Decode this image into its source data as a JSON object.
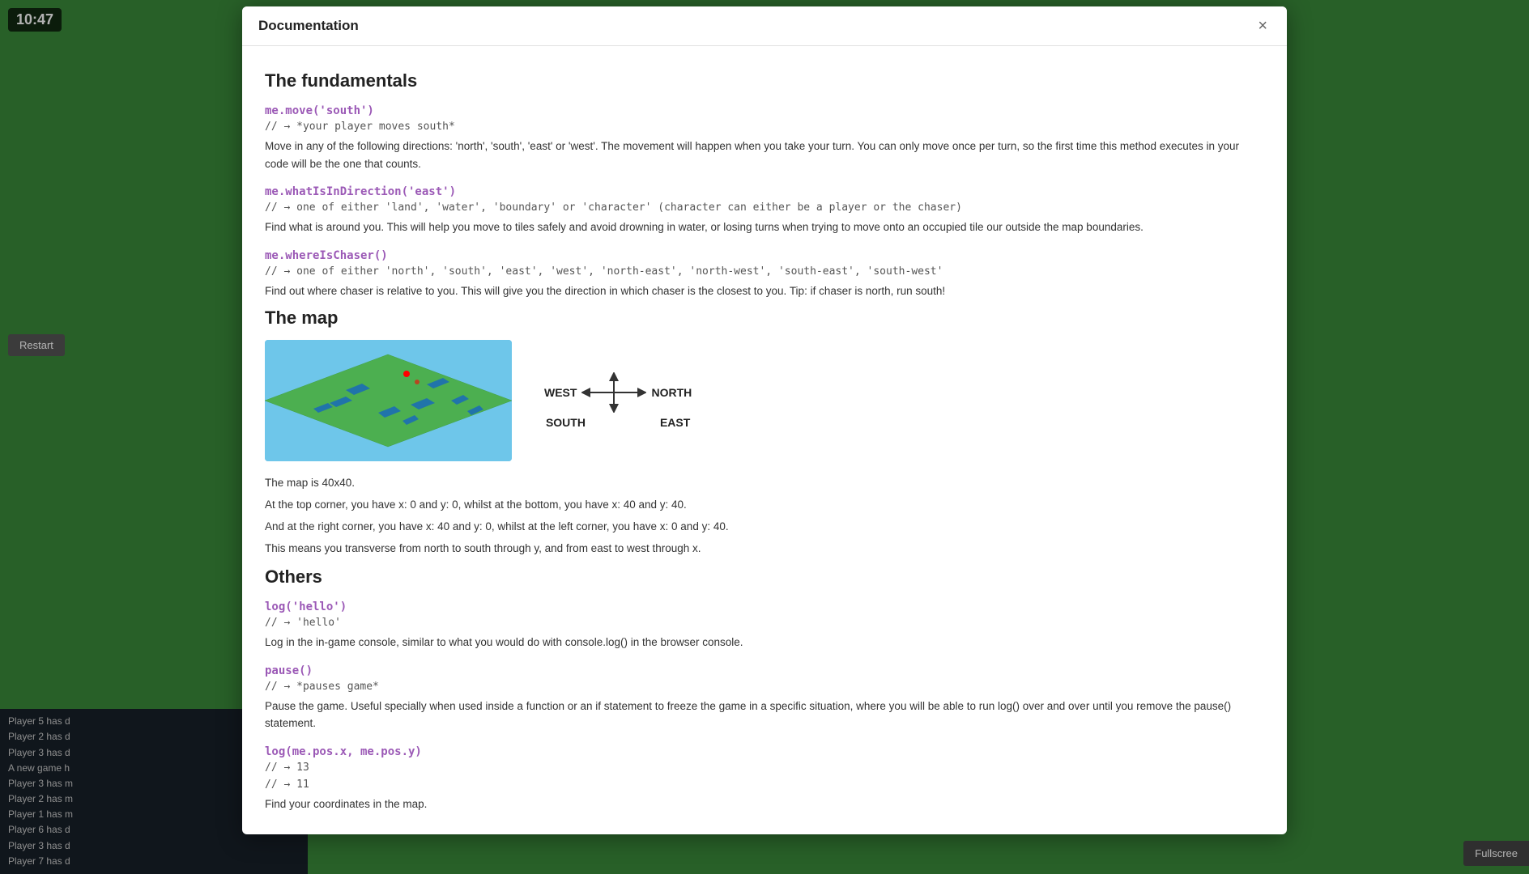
{
  "clock": {
    "time": "10:47"
  },
  "modal": {
    "title": "Documentation",
    "close_label": "×"
  },
  "fundamentals": {
    "heading": "The fundamentals",
    "methods": [
      {
        "name": "me.move('south')",
        "comment": "// → *your player moves south*",
        "description": "Move in any of the following directions: 'north', 'south', 'east' or 'west'. The movement will happen when you take your turn. You can only move once per turn, so the first time this method executes in your code will be the one that counts."
      },
      {
        "name": "me.whatIsInDirection('east')",
        "comment": "// → one of either 'land', 'water', 'boundary' or 'character' (character can either be a player or the chaser)",
        "description": "Find what is around you. This will help you move to tiles safely and avoid drowning in water, or losing turns when trying to move onto an occupied tile our outside the map boundaries."
      },
      {
        "name": "me.whereIsChaser()",
        "comment": "// → one of either 'north', 'south', 'east', 'west', 'north-east', 'north-west', 'south-east', 'south-west'",
        "description": "Find out where chaser is relative to you. This will give you the direction in which chaser is the closest to you. Tip: if chaser is north, run south!"
      }
    ]
  },
  "map_section": {
    "heading": "The map",
    "description_lines": [
      "The map is 40x40.",
      "At the top corner, you have x: 0 and y: 0, whilst at the bottom, you have x: 40 and y: 40.",
      "And at the right corner, you have x: 40 and y: 0, whilst at the left corner, you have x: 0 and y: 40.",
      "This means you transverse from north to south through y, and from east to west through x."
    ],
    "directions": {
      "north": "NORTH",
      "south": "SOUTH",
      "east": "EAST",
      "west": "WEST"
    }
  },
  "others": {
    "heading": "Others",
    "methods": [
      {
        "name": "log('hello')",
        "comment": "// → 'hello'",
        "description": "Log in the in-game console, similar to what you would do with console.log() in the browser console."
      },
      {
        "name": "pause()",
        "comment": "// → *pauses game*",
        "description": "Pause the game. Useful specially when used inside a function or an if statement to freeze the game in a specific situation, where you will be able to run log() over and over until you remove the pause() statement."
      },
      {
        "name": "log(me.pos.x, me.pos.y)",
        "comments": [
          "// → 13",
          "// → 11"
        ],
        "description": "Find your coordinates in the map."
      }
    ]
  },
  "log_area": {
    "lines": [
      "Player 5 has d",
      "Player 2 has d",
      "Player 3 has d",
      "A new game h",
      "Player 3 has m",
      "Player 2 has m",
      "Player 1 has m",
      "Player 6 has d",
      "Player 3 has d",
      "Player 7 has d"
    ]
  },
  "buttons": {
    "restart": "Restart",
    "fullscreen": "Fullscree"
  }
}
